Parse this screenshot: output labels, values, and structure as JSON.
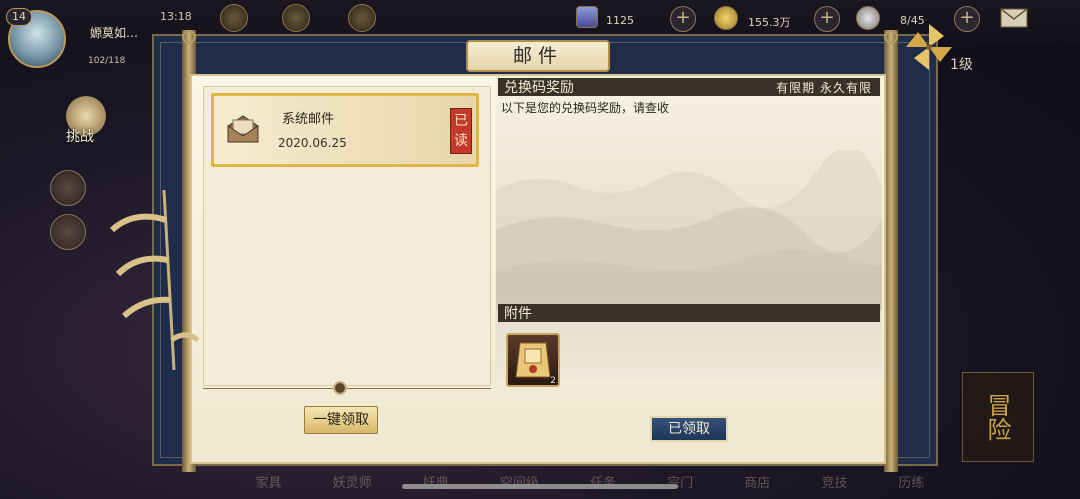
{
  "hud": {
    "level": "14",
    "time": "13:18",
    "player_name": "嫄莫如…",
    "exp_text": "102/118",
    "jade": "1125",
    "coins": "155.3万",
    "stamina": "8/45",
    "partial_label": "1级"
  },
  "side_buttons": {
    "challenge_label": "挑战"
  },
  "bottom_nav": [
    "家具",
    "妖灵师",
    "妖典",
    "空间级",
    "任务",
    "宗门",
    "商店",
    "竞技",
    "历练"
  ],
  "adventure_label": "冒险",
  "mail_panel": {
    "title": "邮件",
    "list": [
      {
        "title": "系统邮件",
        "date": "2020.06.25",
        "status": "已读"
      }
    ],
    "claim_all_label": "一键领取",
    "detail": {
      "subject": "兑换码奖励",
      "validity_label": "有限期",
      "validity_value": "永久有限",
      "body": "以下是您的兑换码奖励，请查收",
      "attachments_label": "附件",
      "attachments": [
        {
          "icon": "reward-item-icon",
          "count": "2"
        }
      ],
      "claimed_label": "已领取"
    }
  },
  "colors": {
    "panel_frame": "#1f2d4a",
    "parchment": "#f3ecd8",
    "gold_border": "#e0b642",
    "stamp_red": "#c33a2a",
    "section_bar": "#3a3228"
  }
}
